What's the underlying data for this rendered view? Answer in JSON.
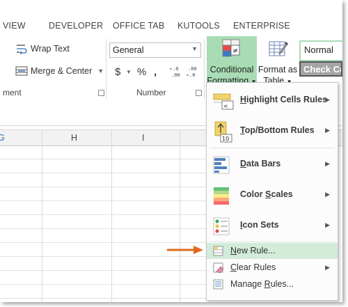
{
  "ribbon_tabs": [
    "VIEW",
    "DEVELOPER",
    "OFFICE TAB",
    "KUTOOLS",
    "ENTERPRISE"
  ],
  "alignment": {
    "wrap_text": "Wrap Text",
    "merge_center": "Merge & Center",
    "group_label_partial": "ment"
  },
  "number": {
    "format_value": "General",
    "currency_symbol": "$",
    "percent_symbol": "%",
    "comma_symbol": ",",
    "group_label": "Number"
  },
  "styles": {
    "conditional_formatting_line1": "Conditional",
    "conditional_formatting_line2": "Formatting",
    "format_as_table_line1": "Format as",
    "format_as_table_line2": "Table",
    "style_normal": "Normal",
    "style_check_cell": "Check Ce"
  },
  "columns": [
    "G",
    "H",
    "I"
  ],
  "menu": {
    "items": [
      {
        "label": "Highlight Cells Rules",
        "hotkey": "H",
        "rest": "ighlight Cells Rules",
        "submenu": true
      },
      {
        "label": "Top/Bottom Rules",
        "hotkey": "T",
        "rest": "op/Bottom Rules",
        "submenu": true
      },
      {
        "label": "Data Bars",
        "hotkey": "D",
        "rest": "ata Bars",
        "submenu": true
      },
      {
        "label": "Color Scales",
        "pre": "Color ",
        "hotkey": "S",
        "rest": "cales",
        "submenu": true
      },
      {
        "label": "Icon Sets",
        "hotkey": "I",
        "rest": "con Sets",
        "submenu": true
      }
    ],
    "new_rule": {
      "hotkey": "N",
      "rest": "ew Rule..."
    },
    "clear_rules": {
      "hotkey": "C",
      "rest": "lear Rules"
    },
    "manage_rules": {
      "pre": "Manage ",
      "hotkey": "R",
      "rest": "ules..."
    }
  },
  "colors": {
    "accent_green": "#a9dcb4",
    "menu_highlight": "#d3ecd9",
    "arrow_orange": "#e06a1e"
  }
}
